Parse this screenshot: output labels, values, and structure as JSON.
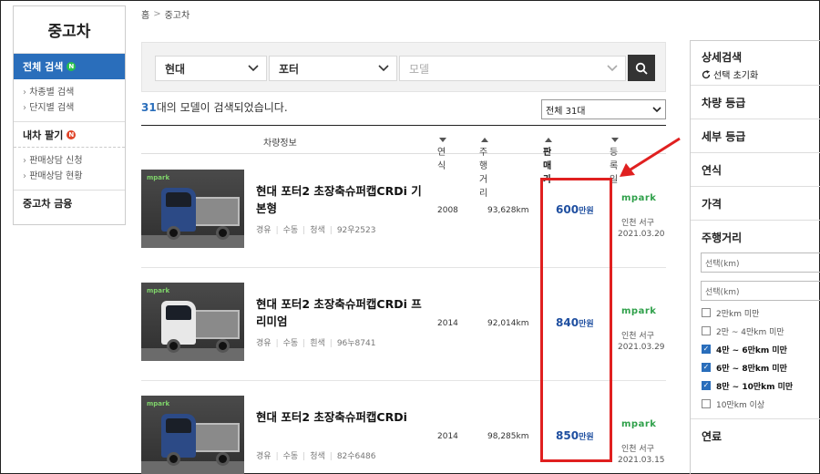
{
  "sidebar": {
    "title": "중고차",
    "active": {
      "label": "전체 검색",
      "badge": "N"
    },
    "sub_items": [
      "차종별 검색",
      "단지별 검색"
    ],
    "sell": {
      "label": "내차 팔기",
      "badge": "N"
    },
    "sell_items": [
      "판매상담 신청",
      "판매상담 현황"
    ],
    "finance": "중고차 금융"
  },
  "breadcrumb": {
    "home": "홈",
    "sep": ">",
    "current": "중고차"
  },
  "search": {
    "maker": "현대",
    "model": "포터",
    "detail_placeholder": "모델"
  },
  "result": {
    "count": "31",
    "suffix": "대의 모델이 검색되었습니다.",
    "sort_select": "전체 31대"
  },
  "table": {
    "headers": {
      "info": "차량정보",
      "year": "연식",
      "mileage": "주행거리",
      "price": "판매가",
      "date": "등록일"
    }
  },
  "listings": [
    {
      "title": "현대 포터2 초장축슈퍼캡CRDi 기본형",
      "fuel": "경유",
      "trans": "수동",
      "color": "청색",
      "plate": "92우2523",
      "year": "2008",
      "km": "93,628km",
      "price": "600",
      "price_unit": "만원",
      "dealer": "mpark",
      "location": "인천 서구",
      "date": "2021.03.20",
      "truck_color": "#2c4a86"
    },
    {
      "title": "현대 포터2 초장축슈퍼캡CRDi 프리미엄",
      "fuel": "경유",
      "trans": "수동",
      "color": "흰색",
      "plate": "96누8741",
      "year": "2014",
      "km": "92,014km",
      "price": "840",
      "price_unit": "만원",
      "dealer": "mpark",
      "location": "인천 서구",
      "date": "2021.03.29",
      "truck_color": "#e8e8e8"
    },
    {
      "title": "현대 포터2 초장축슈퍼캡CRDi",
      "fuel": "경유",
      "trans": "수동",
      "color": "청색",
      "plate": "82수6486",
      "year": "2014",
      "km": "98,285km",
      "price": "850",
      "price_unit": "만원",
      "dealer": "mpark",
      "location": "인천 서구",
      "date": "2021.03.15",
      "truck_color": "#2c4a86"
    }
  ],
  "filter": {
    "title": "상세검색",
    "reset": "선택 초기화",
    "items": [
      "차량 등급",
      "세부 등급",
      "연식",
      "가격"
    ],
    "mileage": {
      "title": "주행거리",
      "min_placeholder": "선택(km)",
      "max_placeholder": "선택(km)",
      "options": [
        {
          "label": "2만km 미만",
          "checked": false
        },
        {
          "label": "2만 ~ 4만km 미만",
          "checked": false
        },
        {
          "label": "4만 ~ 6만km 미만",
          "checked": true
        },
        {
          "label": "6만 ~ 8만km 미만",
          "checked": true
        },
        {
          "label": "8만 ~ 10만km 미만",
          "checked": true
        },
        {
          "label": "10만km 이상",
          "checked": false
        }
      ]
    },
    "fuel": "연료"
  },
  "colors": {
    "brand_blue": "#2a6ebb",
    "price_blue": "#1f4fa0",
    "dealer_green": "#2fa04a",
    "highlight_red": "#e02020"
  }
}
